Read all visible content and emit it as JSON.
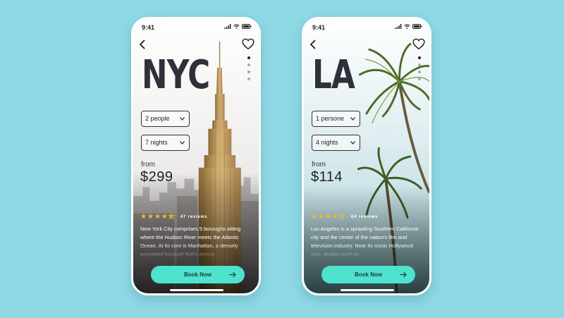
{
  "colors": {
    "background": "#8ed8e4",
    "accent": "#4de3cf",
    "star": "#f2b632",
    "heading": "#2f3039"
  },
  "status_bar": {
    "time": "9:41"
  },
  "icons": {
    "back": "chevron-left-icon",
    "favorite": "heart-icon",
    "book_arrow": "arrow-right-icon"
  },
  "cards": [
    {
      "city": "NYC",
      "guests": "2 people",
      "stay": "7 nights",
      "from_label": "from",
      "price": "$299",
      "rating": 4.5,
      "reviews": "47 reviews",
      "description": "New York City comprises 5 boroughs sitting where the Hudson River meets the Atlantic Ocean. At its core is Manhattan, a densely populated borough that's among",
      "book_label": "Book Now",
      "active_page": 0,
      "page_count": 4
    },
    {
      "city": "LA",
      "guests": "1 persone",
      "stay": "4 nights",
      "from_label": "from",
      "price": "$114",
      "rating": 4,
      "reviews": "64 reviews",
      "description": "Los Angeles is a sprawling Southern California city and the center of the nation's film and television industry. Near its iconic Hollywood sign, studios such as",
      "book_label": "Book Now",
      "active_page": 0,
      "page_count": 4
    }
  ]
}
